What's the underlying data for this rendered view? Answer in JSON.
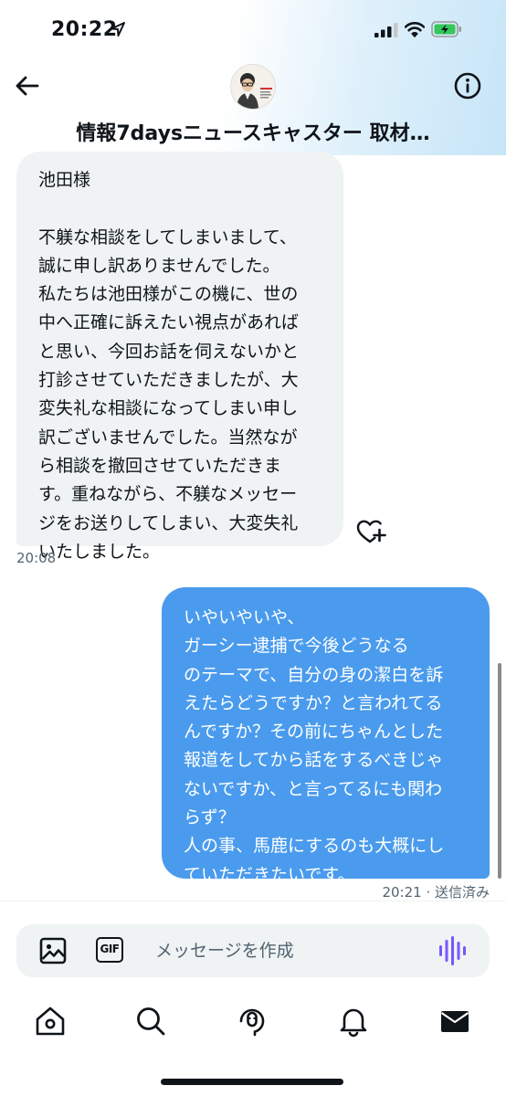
{
  "status_bar": {
    "time": "20:22"
  },
  "header": {
    "title": "情報7daysニュースキャスター 取材…",
    "back_icon": "arrow-left-icon",
    "info_icon": "info-circle-icon"
  },
  "messages": {
    "incoming": {
      "text": "池田様\n\n不躾な相談をしてしまいまして、\n誠に申し訳ありませんでした。\n私たちは池田様がこの機に、世の\n中へ正確に訴えたい視点があれば\nと思い、今回お話を伺えないかと\n打診させていただきましたが、大\n変失礼な相談になってしまい申し\n訳ございませんでした。当然なが\nら相談を撤回させていただきま\nす。重ねながら、不躾なメッセー\nジをお送りしてしまい、大変失礼\nいたしました。",
      "timestamp": "20:08"
    },
    "outgoing": {
      "text": "いやいやいや、\nガーシー逮捕で今後どうなる\nのテーマで、自分の身の潔白を訴\nえたらどうですか？と言われてる\nんですか？その前にちゃんとした\n報道をしてから話をするべきじゃ\nないですか、と言ってるにも関わ\nらず？\n人の事、馬鹿にするのも大概にし\nていただきたいです。",
      "timestamp": "20:21 · 送信済み"
    }
  },
  "composer": {
    "placeholder": "メッセージを作成",
    "gif_label": "GIF"
  },
  "colors": {
    "outgoing_bubble": "#4a9bed",
    "incoming_bubble": "#eff3f4",
    "voice_icon": "#7856ff"
  }
}
